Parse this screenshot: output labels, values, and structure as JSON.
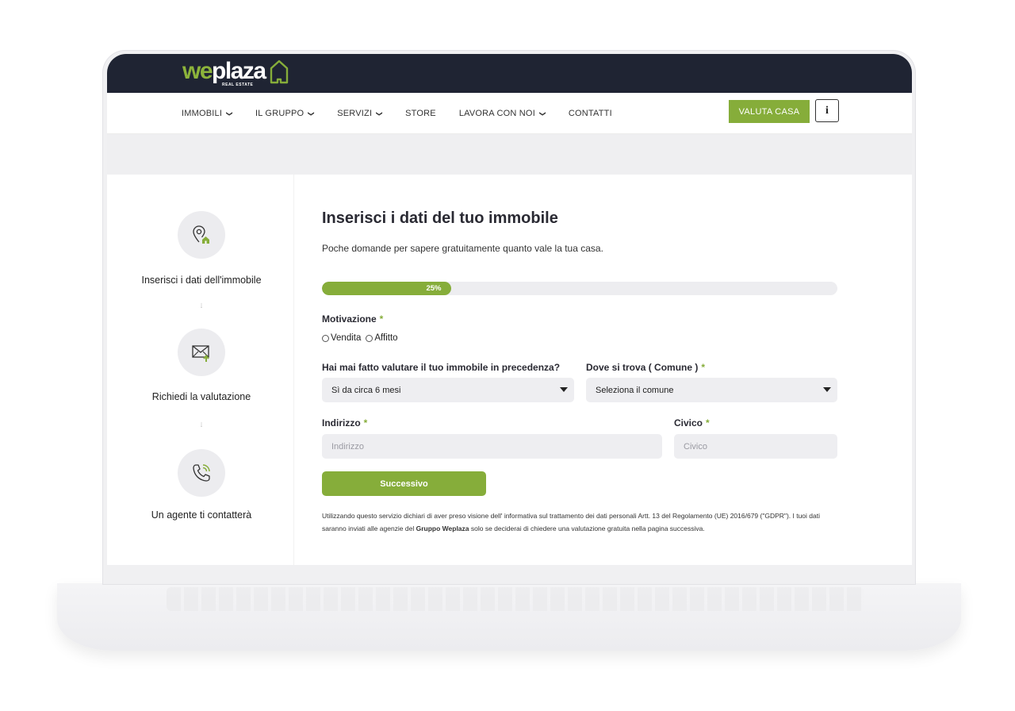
{
  "brand": {
    "logo_we": "we",
    "logo_plaza": "plaza",
    "logo_sub": "REAL ESTATE",
    "accent": "#86ad3a",
    "header_bg": "#1f2433"
  },
  "nav": {
    "items": [
      {
        "label": "IMMOBILI",
        "dropdown": true
      },
      {
        "label": "IL GRUPPO",
        "dropdown": true
      },
      {
        "label": "SERVIZI",
        "dropdown": true
      },
      {
        "label": "STORE",
        "dropdown": false
      },
      {
        "label": "LAVORA CON NOI",
        "dropdown": true
      },
      {
        "label": "CONTATTI",
        "dropdown": false
      }
    ],
    "cta_label": "VALUTA CASA",
    "info_label": "i"
  },
  "steps": [
    {
      "label": "Inserisci i dati dell'immobile",
      "icon": "map-pin-home-icon"
    },
    {
      "label": "Richiedi la valutazione",
      "icon": "envelope-upload-icon"
    },
    {
      "label": "Un agente ti contatterà",
      "icon": "phone-ringing-icon"
    }
  ],
  "form": {
    "title": "Inserisci i dati del tuo immobile",
    "subtitle": "Poche domande per sapere gratuitamente quanto vale la tua casa.",
    "progress": {
      "label": "25%",
      "value": 0.25
    },
    "motivazione": {
      "label": "Motivazione",
      "required": "*",
      "options": [
        "Vendita",
        "Affitto"
      ]
    },
    "valutazione": {
      "label": "Hai mai fatto valutare il tuo immobile in precedenza?",
      "value": "Sì da circa 6 mesi"
    },
    "comune": {
      "label": "Dove si trova ( Comune )",
      "required": "*",
      "value": "Seleziona il comune"
    },
    "indirizzo": {
      "label": "Indirizzo",
      "required": "*",
      "placeholder": "Indirizzo"
    },
    "civico": {
      "label": "Civico",
      "required": "*",
      "placeholder": "Civico"
    },
    "next_label": "Successivo",
    "privacy_1": "Utilizzando questo servizio dichiari di aver preso visione dell' informativa sul trattamento dei dati personali Artt. 13 del Regolamento (UE) 2016/679 (\"GDPR\"). I tuoi dati saranno inviati alle agenzie del ",
    "privacy_bold": "Gruppo Weplaza",
    "privacy_2": " solo se deciderai di chiedere una valutazione gratuita nella pagina successiva."
  }
}
